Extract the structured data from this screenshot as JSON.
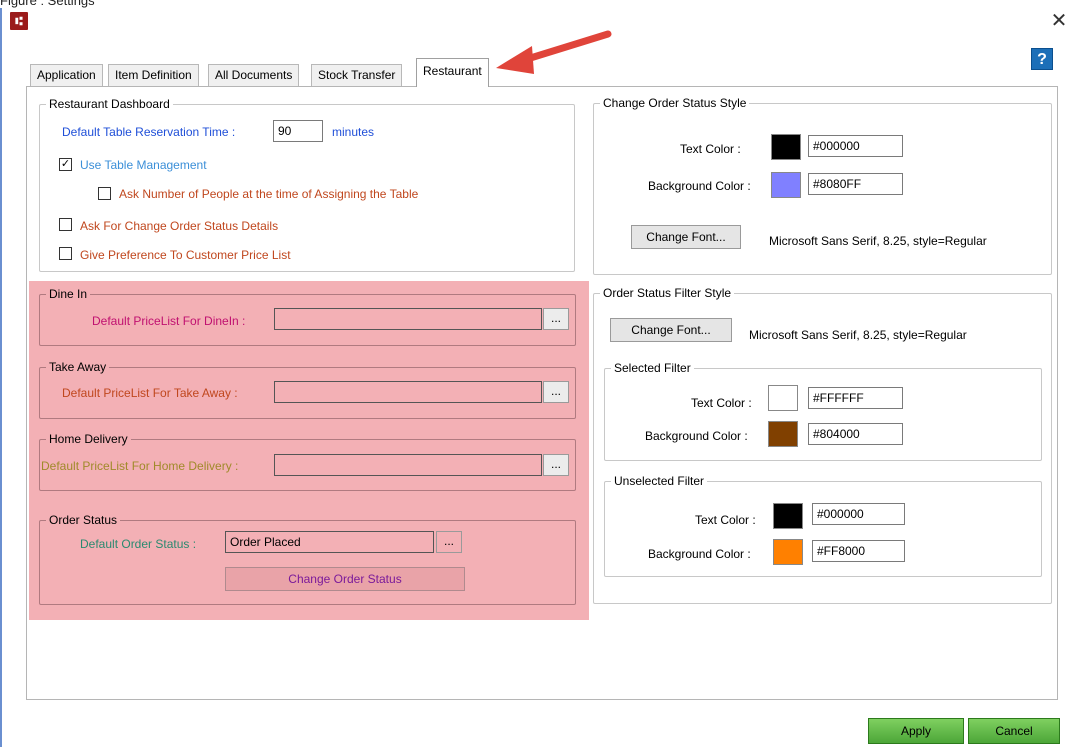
{
  "window": {
    "top_cut_text": "Figure : Settings",
    "close_glyph": "✕",
    "help_glyph": "?"
  },
  "tabs": [
    {
      "label": "Application"
    },
    {
      "label": "Item Definition"
    },
    {
      "label": "All Documents"
    },
    {
      "label": "Stock Transfer"
    },
    {
      "label": "Restaurant",
      "active": true
    }
  ],
  "restaurant_dashboard": {
    "title": "Restaurant Dashboard",
    "reservation_label": "Default Table Reservation Time :",
    "reservation_value": "90",
    "reservation_unit": "minutes",
    "use_table_mgmt": {
      "label": "Use Table Management",
      "checked": true
    },
    "ask_people": {
      "label": "Ask Number of People at the time of Assigning the Table",
      "checked": false
    },
    "ask_change_status": {
      "label": "Ask For Change Order Status Details",
      "checked": false
    },
    "customer_pricelist": {
      "label": "Give Preference To Customer  Price List",
      "checked": false
    }
  },
  "dine_in": {
    "title": "Dine In",
    "label": "Default PriceList For DineIn :",
    "value": "",
    "browse": "..."
  },
  "take_away": {
    "title": "Take Away",
    "label": "Default PriceList For Take Away :",
    "value": "",
    "browse": "..."
  },
  "home_delivery": {
    "title": "Home Delivery",
    "label": "Default PriceList For Home Delivery :",
    "value": "",
    "browse": "..."
  },
  "order_status": {
    "title": "Order Status",
    "label": "Default Order Status :",
    "value": "Order Placed",
    "browse": "...",
    "change_button": "Change Order Status"
  },
  "change_order_status_style": {
    "title": "Change Order Status Style",
    "text_color_label": "Text Color :",
    "text_color": "#000000",
    "bg_color_label": "Background Color :",
    "bg_color": "#8080FF",
    "change_font_button": "Change Font...",
    "font_desc": "Microsoft Sans Serif, 8.25, style=Regular"
  },
  "order_status_filter_style": {
    "title": "Order Status Filter Style",
    "change_font_button": "Change Font...",
    "font_desc": "Microsoft Sans Serif, 8.25, style=Regular",
    "selected": {
      "title": "Selected Filter",
      "text_color_label": "Text Color :",
      "text_color": "#FFFFFF",
      "bg_color_label": "Background Color :",
      "bg_color": "#804000"
    },
    "unselected": {
      "title": "Unselected Filter",
      "text_color_label": "Text Color :",
      "text_color": "#000000",
      "bg_color_label": "Background Color :",
      "bg_color": "#FF8000"
    }
  },
  "footer": {
    "apply": "Apply",
    "cancel": "Cancel"
  },
  "colors": {
    "highlight": "#f3b0b5",
    "arrow": "#e0443a",
    "apply_green": "#5cb844"
  }
}
